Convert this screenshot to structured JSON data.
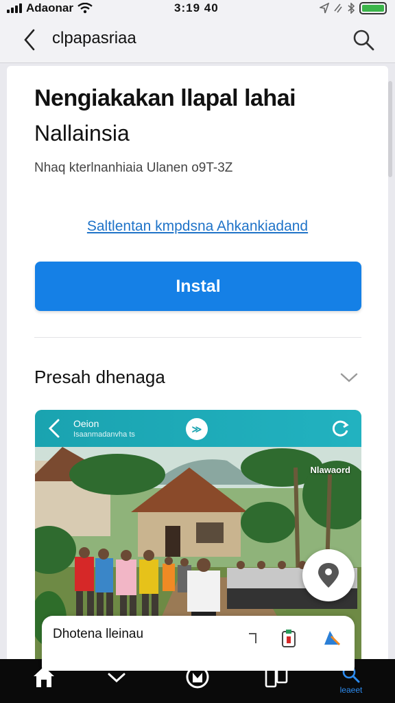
{
  "status_bar": {
    "carrier": "Adaonar",
    "time": "3:19 40",
    "battery_color": "#3bb54a"
  },
  "nav": {
    "title": "clpapasriaa",
    "back_icon": "chevron-left-icon",
    "search_icon": "search-icon"
  },
  "app": {
    "title": "Nengiakakan llapal lahai",
    "subtitle": "Nallainsia",
    "meta": "Nhaq kterlnanhiaia Ulanen o9T-3Z",
    "link": "Saltlentan kmpdsna Ahkankiadand",
    "install_label": "Instal",
    "accent_color": "#1580e6"
  },
  "section": {
    "title": "Presah dhenaga",
    "chevron_icon": "chevron-down-icon"
  },
  "preview": {
    "header_title": "Oeion",
    "header_sub": "Isaanmadanvha ts",
    "center_badge": "≫",
    "corner_label": "Nlawaord",
    "card_title": "Dhotena lleinau",
    "header_color": "#1aa3b0"
  },
  "tabbar": {
    "items": [
      {
        "icon": "home-icon",
        "label": ""
      },
      {
        "icon": "chevron-down-icon",
        "label": ""
      },
      {
        "icon": "games-icon",
        "label": ""
      },
      {
        "icon": "apps-icon",
        "label": ""
      },
      {
        "icon": "search-icon",
        "label": "leaeet"
      }
    ],
    "active_color": "#2d8cf0"
  }
}
